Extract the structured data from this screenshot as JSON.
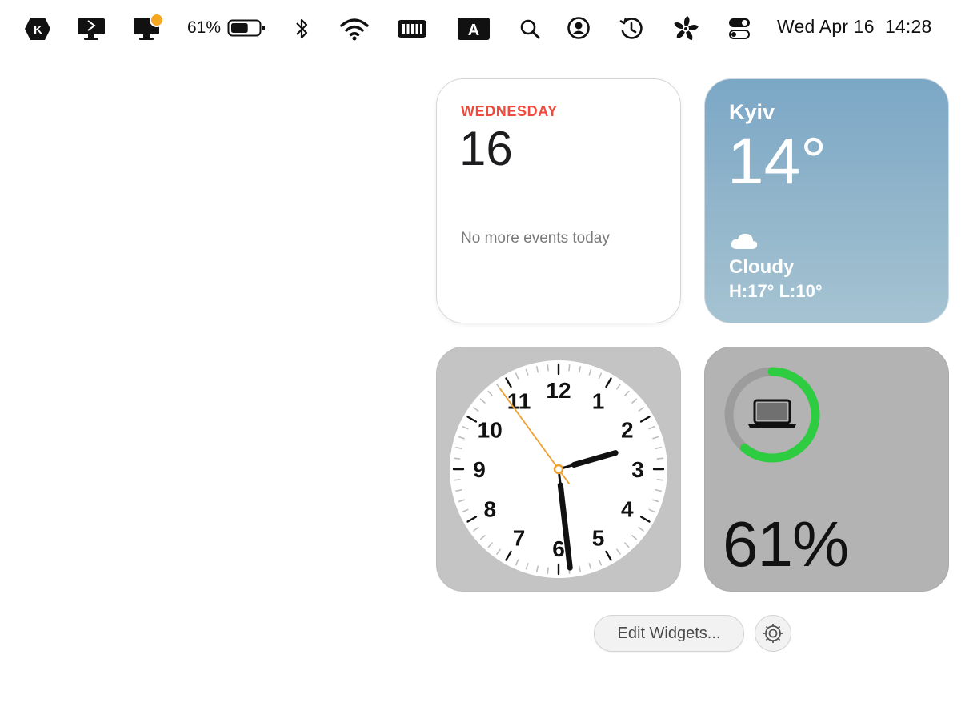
{
  "menubar": {
    "icons": [
      "keyboard-maestro-icon",
      "display-icon",
      "display-notification-icon",
      "battery-icon",
      "bluetooth-icon",
      "wifi-icon",
      "memory-icon",
      "input-source-icon",
      "spotlight-search-icon",
      "user-account-icon",
      "time-machine-icon",
      "fan-icon",
      "control-center-icon"
    ],
    "battery_percent": "61%",
    "battery_level": 0.61,
    "input_source_letter": "A",
    "datetime": "Wed Apr 16  14:28",
    "notification_dot_color": "#f5a623"
  },
  "calendar_widget": {
    "weekday": "WEDNESDAY",
    "day": "16",
    "note": "No more events today",
    "accent_color": "#f04a3c"
  },
  "weather_widget": {
    "city": "Kyiv",
    "temperature": "14°",
    "condition": "Cloudy",
    "high_low": "H:17° L:10°",
    "icon": "cloud-icon"
  },
  "clock_widget": {
    "numerals": [
      "12",
      "1",
      "2",
      "3",
      "4",
      "5",
      "6",
      "7",
      "8",
      "9",
      "10",
      "11"
    ],
    "time": {
      "hour": 2,
      "minute": 28,
      "second": 54
    },
    "second_hand_color": "#f0a030"
  },
  "battery_widget": {
    "percent_label": "61%",
    "level": 0.61,
    "device_icon": "laptop-icon",
    "ring_color": "#2ecc40"
  },
  "footer": {
    "edit_label": "Edit Widgets...",
    "settings_icon": "gear-icon"
  }
}
